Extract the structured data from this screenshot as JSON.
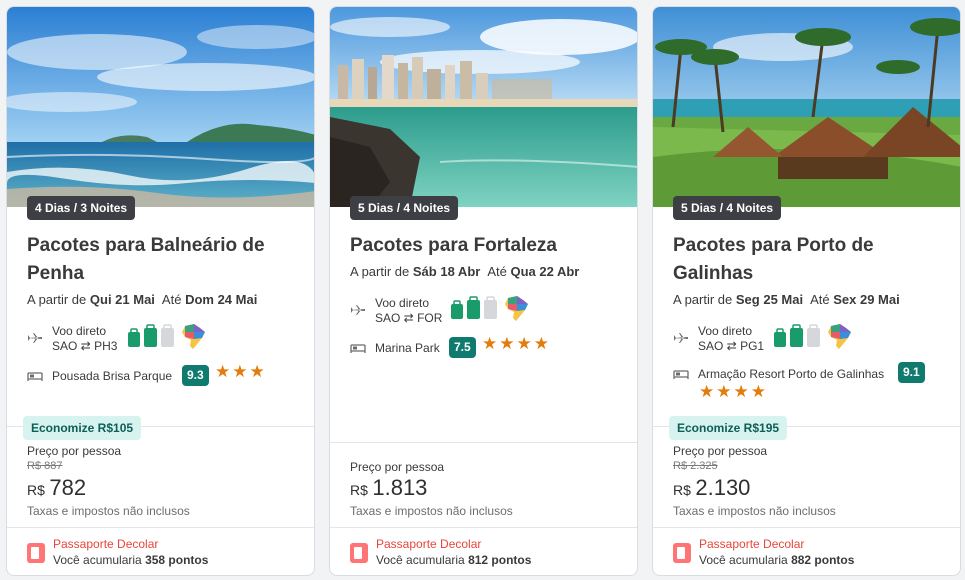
{
  "cards": [
    {
      "duration": "4 Dias / 3 Noites",
      "title": "Pacotes para Balneário de Penha",
      "dates": {
        "prefix": "A partir de",
        "start": "Qui 21 Mai",
        "until": "Até",
        "end": "Dom 24 Mai"
      },
      "flight": {
        "type": "Voo direto",
        "route_from": "SAO",
        "route_to": "PH3"
      },
      "hotel": {
        "name": "Pousada Brisa Parque",
        "score": "9.3",
        "stars": "★★★"
      },
      "savings": "Economize R$105",
      "price_label": "Preço por pessoa",
      "old_price": "R$ 887",
      "currency": "R$",
      "price": "782",
      "taxes": "Taxas e impostos não inclusos",
      "passport": {
        "title": "Passaporte Decolar",
        "text": "Você acumularia",
        "points": "358 pontos"
      }
    },
    {
      "duration": "5 Dias / 4 Noites",
      "title": "Pacotes para Fortaleza",
      "dates": {
        "prefix": "A partir de",
        "start": "Sáb 18 Abr",
        "until": "Até",
        "end": "Qua 22 Abr"
      },
      "flight": {
        "type": "Voo direto",
        "route_from": "SAO",
        "route_to": "FOR"
      },
      "hotel": {
        "name": "Marina Park",
        "score": "7.5",
        "stars": "★★★★"
      },
      "price_label": "Preço por pessoa",
      "currency": "R$",
      "price": "1.813",
      "taxes": "Taxas e impostos não inclusos",
      "passport": {
        "title": "Passaporte Decolar",
        "text": "Você acumularia",
        "points": "812 pontos"
      }
    },
    {
      "duration": "5 Dias / 4 Noites",
      "title": "Pacotes para Porto de Galinhas",
      "dates": {
        "prefix": "A partir de",
        "start": "Seg 25 Mai",
        "until": "Até",
        "end": "Sex 29 Mai"
      },
      "flight": {
        "type": "Voo direto",
        "route_from": "SAO",
        "route_to": "PG1"
      },
      "hotel": {
        "name": "Armação Resort Porto de Galinhas",
        "score": "9.1",
        "stars": "★★★★"
      },
      "savings": "Economize R$195",
      "price_label": "Preço por pessoa",
      "old_price": "R$ 2.325",
      "currency": "R$",
      "price": "2.130",
      "taxes": "Taxas e impostos não inclusos",
      "passport": {
        "title": "Passaporte Decolar",
        "text": "Você acumularia",
        "points": "882 pontos"
      }
    }
  ],
  "icons": {
    "flight": "airplane-icon",
    "baggage": "luggage-icon",
    "destination": "brazil-map-icon",
    "hotel": "bed-icon",
    "passport": "passport-icon"
  },
  "colors": {
    "score_badge": "#0f7a6e",
    "stars": "#e37c0c",
    "savings_bg": "#d7f3f0",
    "passport_accent": "#e8453c",
    "duration_badge": "#3d3f45"
  }
}
